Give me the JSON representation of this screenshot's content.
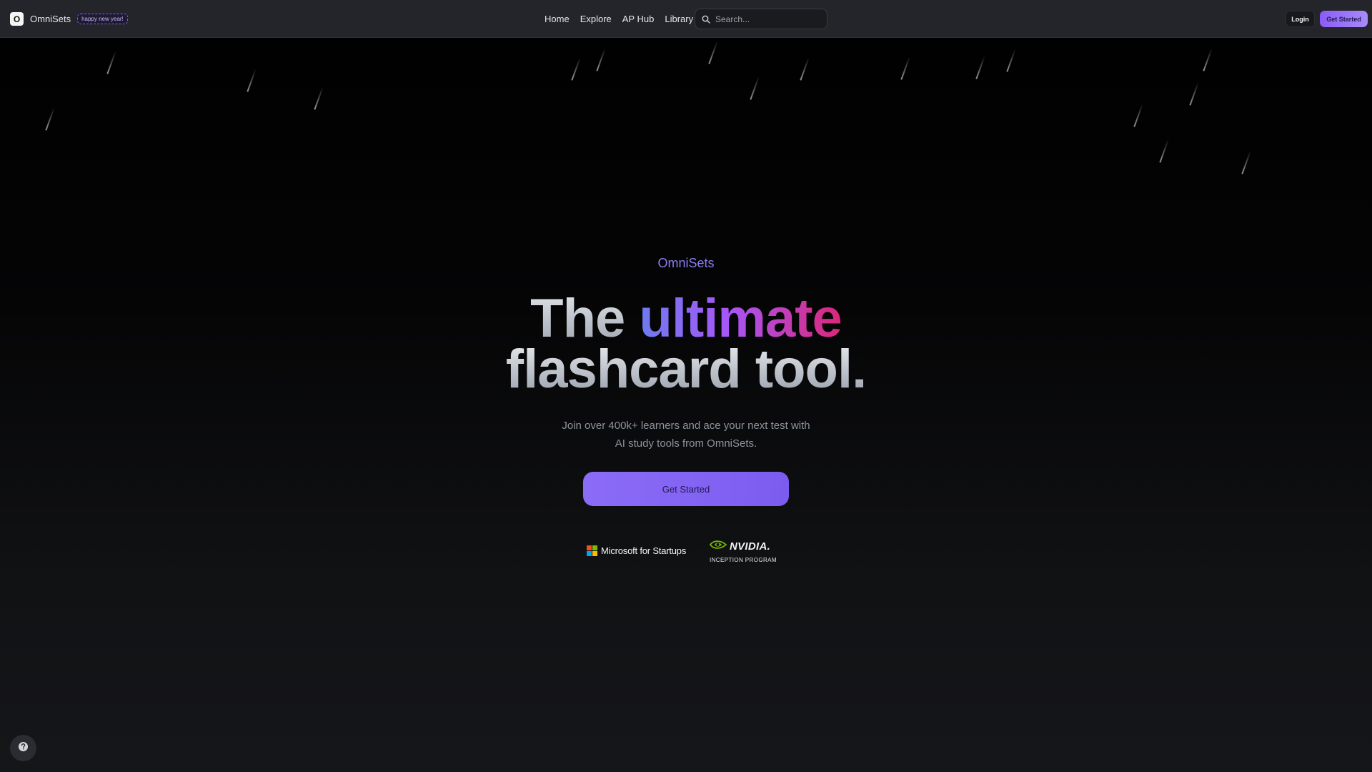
{
  "brand": {
    "logo_letter": "O",
    "name": "OmniSets",
    "badge": "happy new year!"
  },
  "nav": {
    "links": [
      "Home",
      "Explore",
      "AP Hub",
      "Library"
    ]
  },
  "search": {
    "placeholder": "Search..."
  },
  "auth": {
    "login": "Login",
    "get_started": "Get Started"
  },
  "hero": {
    "eyebrow": "OmniSets",
    "title_part1": "The",
    "title_accent": "ultimate",
    "title_line2": "flashcard tool.",
    "subtitle_line1": "Join over 400k+ learners and ace your next test with",
    "subtitle_line2": "AI study tools from OmniSets.",
    "cta": "Get Started"
  },
  "partners": {
    "microsoft": "Microsoft for Startups",
    "nvidia_word": "NVIDIA.",
    "nvidia_program": "INCEPTION PROGRAM"
  },
  "icons": {
    "search": "search-icon",
    "help": "question-circle-icon",
    "microsoft": "microsoft-logo",
    "nvidia": "nvidia-eye-logo"
  },
  "colors": {
    "accent": "#8b5cf6",
    "navbar_bg": "#23252a",
    "page_bg": "#000000",
    "title_gradient": [
      "#6d7cf0",
      "#a855f7",
      "#db2777"
    ]
  }
}
